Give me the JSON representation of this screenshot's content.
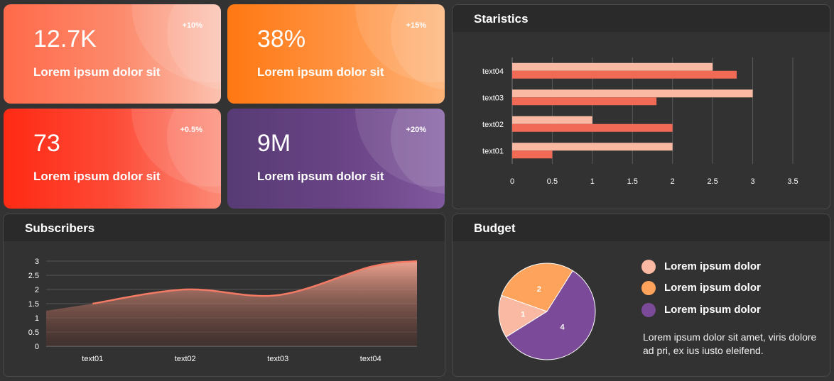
{
  "kpis": [
    {
      "value": "12.7K",
      "label": "Lorem ipsum dolor sit",
      "badge": "+10%"
    },
    {
      "value": "38%",
      "label": "Lorem ipsum dolor sit",
      "badge": "+15%"
    },
    {
      "value": "73",
      "label": "Lorem ipsum dolor sit",
      "badge": "+0.5%"
    },
    {
      "value": "9M",
      "label": "Lorem ipsum dolor sit",
      "badge": "+20%"
    }
  ],
  "colors": {
    "background": "#333333",
    "bar_light": "#f9b9a3",
    "bar_dark": "#f16a55",
    "pie_1": "#f9b9a3",
    "pie_2": "#fda35c",
    "pie_4": "#7b4a98",
    "area_line": "#f37a64"
  },
  "statistics": {
    "title": "Staristics",
    "chart_data": {
      "type": "bar",
      "orientation": "horizontal",
      "categories": [
        "text01",
        "text02",
        "text03",
        "text04"
      ],
      "series": [
        {
          "values": [
            2,
            1,
            3,
            2.5
          ],
          "color": "#f9b9a3"
        },
        {
          "values": [
            0.5,
            2,
            1.8,
            2.8
          ],
          "color": "#f16a55"
        }
      ],
      "xlim": [
        0,
        3.5
      ],
      "xticks": [
        "0",
        "0.5",
        "1",
        "1.5",
        "2",
        "2.5",
        "3",
        "3.5"
      ],
      "grid": true
    }
  },
  "subscribers": {
    "title": "Subscribers",
    "chart_data": {
      "type": "area",
      "categories": [
        "text01",
        "text02",
        "text03",
        "text04"
      ],
      "values": [
        1.5,
        2.0,
        1.8,
        2.8
      ],
      "ylim": [
        0,
        3
      ],
      "yticks": [
        "0",
        "0.5",
        "1",
        "1.5",
        "2",
        "2.5",
        "3"
      ],
      "grid": true
    }
  },
  "budget": {
    "title": "Budget",
    "chart_data": {
      "type": "pie",
      "labels": [
        "1",
        "2",
        "4"
      ],
      "values": [
        1,
        2,
        4
      ],
      "colors": [
        "#f9b9a3",
        "#fda35c",
        "#7b4a98"
      ]
    },
    "legend": [
      {
        "label": "Lorem ipsum dolor",
        "color": "#f9b9a3"
      },
      {
        "label": "Lorem ipsum dolor",
        "color": "#fda35c"
      },
      {
        "label": "Lorem ipsum dolor",
        "color": "#7b4a98"
      }
    ],
    "description": "Lorem ipsum dolor sit amet, viris dolore ad pri, ex ius iusto eleifend."
  }
}
